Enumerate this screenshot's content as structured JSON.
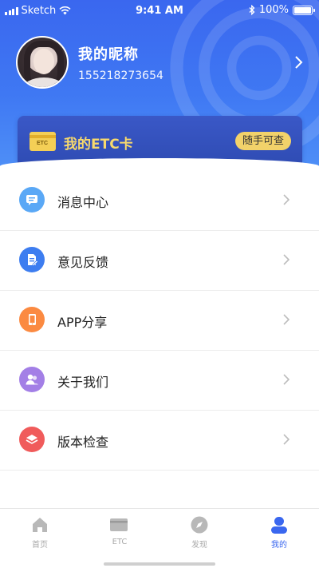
{
  "status_bar": {
    "carrier": "Sketch",
    "time": "9:41 AM",
    "battery": "100%"
  },
  "profile": {
    "nickname": "我的昵称",
    "phone": "155218273654"
  },
  "etc_card": {
    "icon_text": "ETC",
    "title": "我的ETC卡",
    "badge": "随手可查"
  },
  "menu": [
    {
      "label": "消息中心",
      "icon": "message-icon",
      "color": "#5aa8f6"
    },
    {
      "label": "意见反馈",
      "icon": "feedback-icon",
      "color": "#3d7df0"
    },
    {
      "label": "APP分享",
      "icon": "phone-icon",
      "color": "#fb8a41"
    },
    {
      "label": "关于我们",
      "icon": "people-icon",
      "color": "#a37fe6"
    },
    {
      "label": "版本检查",
      "icon": "layers-icon",
      "color": "#f05b5b"
    }
  ],
  "tabs": [
    {
      "label": "首页",
      "icon": "home-icon",
      "active": false
    },
    {
      "label": "ETC",
      "icon": "etc-card-icon",
      "active": false
    },
    {
      "label": "发现",
      "icon": "compass-icon",
      "active": false
    },
    {
      "label": "我的",
      "icon": "user-icon",
      "active": true
    }
  ],
  "colors": {
    "primary": "#3a67ef",
    "accent_gold": "#f2d26a",
    "tab_inactive": "#a9a9a9"
  }
}
